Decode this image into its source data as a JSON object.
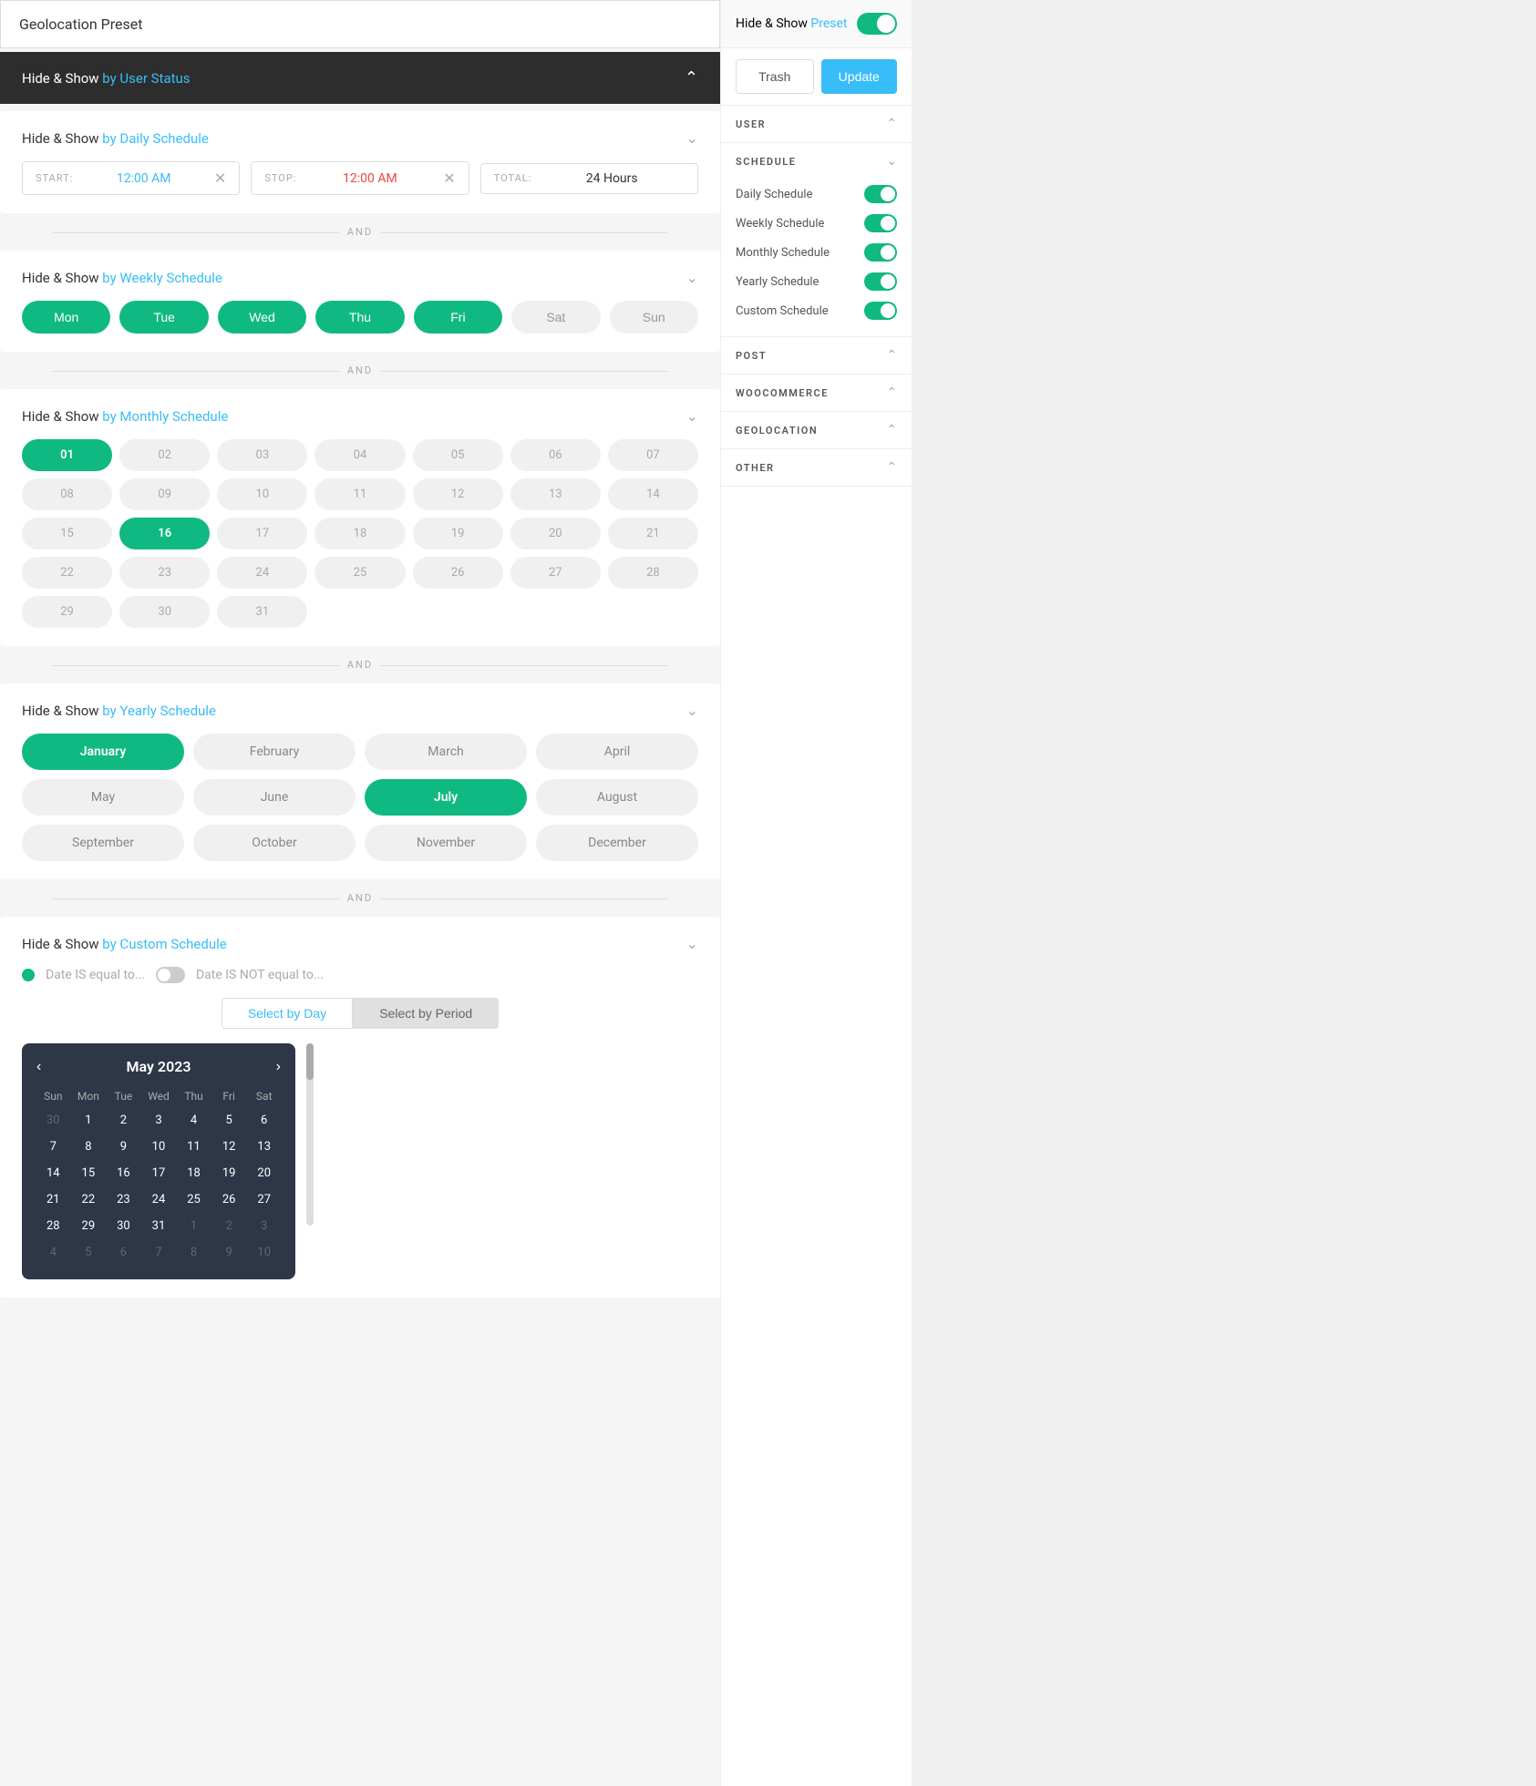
{
  "leftPanel": {
    "presetTitle": "Geolocation Preset",
    "userStatusBar": {
      "label": "Hide & Show",
      "highlight": "by User Status"
    },
    "dailySchedule": {
      "sectionLabel": "Hide & Show",
      "highlight": "by Daily Schedule",
      "startLabel": "START:",
      "startValue": "12:00 AM",
      "stopLabel": "STOP:",
      "stopValue": "12:00 AM",
      "totalLabel": "TOTAL:",
      "totalValue": "24 Hours"
    },
    "andDivider": "AND",
    "weeklySchedule": {
      "sectionLabel": "Hide & Show",
      "highlight": "by Weekly Schedule",
      "days": [
        {
          "label": "Mon",
          "active": true
        },
        {
          "label": "Tue",
          "active": true
        },
        {
          "label": "Wed",
          "active": true
        },
        {
          "label": "Thu",
          "active": true
        },
        {
          "label": "Fri",
          "active": true
        },
        {
          "label": "Sat",
          "active": false
        },
        {
          "label": "Sun",
          "active": false
        }
      ]
    },
    "monthlySchedule": {
      "sectionLabel": "Hide & Show",
      "highlight": "by Monthly Schedule",
      "days": [
        {
          "num": "01",
          "active": true
        },
        {
          "num": "02",
          "active": false
        },
        {
          "num": "03",
          "active": false
        },
        {
          "num": "04",
          "active": false
        },
        {
          "num": "05",
          "active": false
        },
        {
          "num": "06",
          "active": false
        },
        {
          "num": "07",
          "active": false
        },
        {
          "num": "08",
          "active": false
        },
        {
          "num": "09",
          "active": false
        },
        {
          "num": "10",
          "active": false
        },
        {
          "num": "11",
          "active": false
        },
        {
          "num": "12",
          "active": false
        },
        {
          "num": "13",
          "active": false
        },
        {
          "num": "14",
          "active": false
        },
        {
          "num": "15",
          "active": false
        },
        {
          "num": "16",
          "active": true
        },
        {
          "num": "17",
          "active": false
        },
        {
          "num": "18",
          "active": false
        },
        {
          "num": "19",
          "active": false
        },
        {
          "num": "20",
          "active": false
        },
        {
          "num": "21",
          "active": false
        },
        {
          "num": "22",
          "active": false
        },
        {
          "num": "23",
          "active": false
        },
        {
          "num": "24",
          "active": false
        },
        {
          "num": "25",
          "active": false
        },
        {
          "num": "26",
          "active": false
        },
        {
          "num": "27",
          "active": false
        },
        {
          "num": "28",
          "active": false
        },
        {
          "num": "29",
          "active": false
        },
        {
          "num": "30",
          "active": false
        },
        {
          "num": "31",
          "active": false
        }
      ]
    },
    "yearlySchedule": {
      "sectionLabel": "Hide & Show",
      "highlight": "by Yearly Schedule",
      "months": [
        {
          "label": "January",
          "active": true
        },
        {
          "label": "February",
          "active": false
        },
        {
          "label": "March",
          "active": false
        },
        {
          "label": "April",
          "active": false
        },
        {
          "label": "May",
          "active": false
        },
        {
          "label": "June",
          "active": false
        },
        {
          "label": "July",
          "active": true
        },
        {
          "label": "August",
          "active": false
        },
        {
          "label": "September",
          "active": false
        },
        {
          "label": "October",
          "active": false
        },
        {
          "label": "November",
          "active": false
        },
        {
          "label": "December",
          "active": false
        }
      ]
    },
    "customSchedule": {
      "sectionLabel": "Hide & Show",
      "highlight": "by Custom Schedule",
      "dateIsLabel": "Date IS equal to...",
      "dateIsNotLabel": "Date IS NOT equal to...",
      "selectByDay": "Select by Day",
      "selectByPeriod": "Select by Period",
      "calendar": {
        "month": "May",
        "year": "2023",
        "dayHeaders": [
          "Sun",
          "Mon",
          "Tue",
          "Wed",
          "Thu",
          "Fri",
          "Sat"
        ],
        "weeks": [
          [
            {
              "day": "30",
              "other": true
            },
            {
              "day": "1"
            },
            {
              "day": "2"
            },
            {
              "day": "3",
              "today": true
            },
            {
              "day": "4"
            },
            {
              "day": "5"
            },
            {
              "day": "6"
            }
          ],
          [
            {
              "day": "7"
            },
            {
              "day": "8"
            },
            {
              "day": "9"
            },
            {
              "day": "10"
            },
            {
              "day": "11"
            },
            {
              "day": "12"
            },
            {
              "day": "13"
            }
          ],
          [
            {
              "day": "14"
            },
            {
              "day": "15"
            },
            {
              "day": "16"
            },
            {
              "day": "17"
            },
            {
              "day": "18"
            },
            {
              "day": "19"
            },
            {
              "day": "20"
            }
          ],
          [
            {
              "day": "21"
            },
            {
              "day": "22"
            },
            {
              "day": "23"
            },
            {
              "day": "24"
            },
            {
              "day": "25"
            },
            {
              "day": "26"
            },
            {
              "day": "27"
            }
          ],
          [
            {
              "day": "28"
            },
            {
              "day": "29"
            },
            {
              "day": "30"
            },
            {
              "day": "31"
            },
            {
              "day": "1",
              "other": true
            },
            {
              "day": "2",
              "other": true
            },
            {
              "day": "3",
              "other": true
            }
          ],
          [
            {
              "day": "4",
              "other": true
            },
            {
              "day": "5",
              "other": true
            },
            {
              "day": "6",
              "other": true
            },
            {
              "day": "7",
              "other": true
            },
            {
              "day": "8",
              "other": true
            },
            {
              "day": "9",
              "other": true
            },
            {
              "day": "10",
              "other": true
            }
          ]
        ]
      }
    }
  },
  "rightPanel": {
    "presetLabel": "Hide & Show",
    "presetHighlight": "Preset",
    "trashLabel": "Trash",
    "updateLabel": "Update",
    "sections": {
      "user": {
        "label": "USER",
        "expanded": true
      },
      "schedule": {
        "label": "SCHEDULE",
        "expanded": true,
        "items": [
          {
            "label": "Daily Schedule",
            "on": true
          },
          {
            "label": "Weekly Schedule",
            "on": true
          },
          {
            "label": "Monthly Schedule",
            "on": true
          },
          {
            "label": "Yearly Schedule",
            "on": true
          },
          {
            "label": "Custom Schedule",
            "on": true
          }
        ]
      },
      "post": {
        "label": "POST",
        "expanded": false
      },
      "woocommerce": {
        "label": "WOOCOMMERCE",
        "expanded": false
      },
      "geolocation": {
        "label": "GEOLOCATION",
        "expanded": false
      },
      "other": {
        "label": "OTHER",
        "expanded": false
      }
    }
  }
}
